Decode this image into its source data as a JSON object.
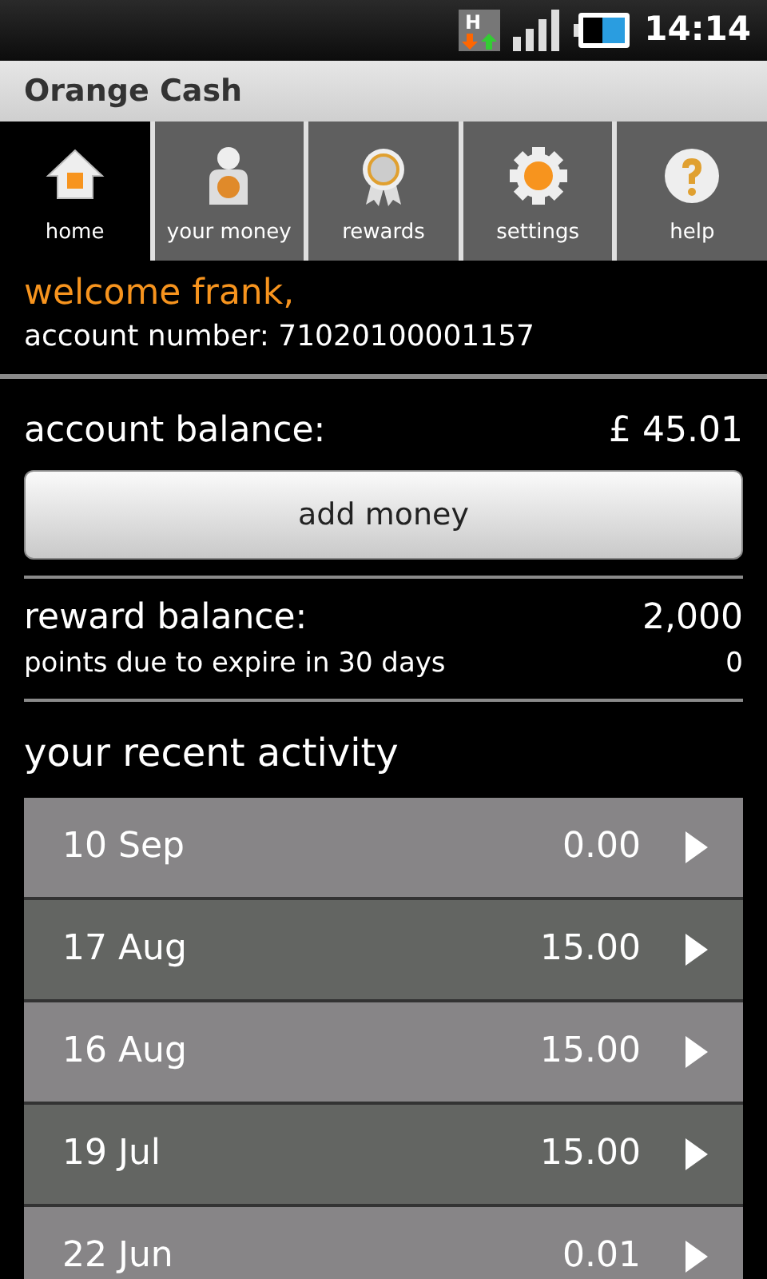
{
  "status_bar": {
    "network": "H",
    "time": "14:14"
  },
  "window": {
    "title": "Orange Cash"
  },
  "tabs": [
    {
      "label": "home",
      "kind": "house",
      "selected": true
    },
    {
      "label": "your money",
      "kind": "person",
      "selected": false
    },
    {
      "label": "rewards",
      "kind": "rosette",
      "selected": false
    },
    {
      "label": "settings",
      "kind": "gear",
      "selected": false
    },
    {
      "label": "help",
      "kind": "question",
      "selected": false
    }
  ],
  "welcome": {
    "greeting": "welcome frank,",
    "account_number": "account number: 71020100001157"
  },
  "account_balance": {
    "label": "account balance:",
    "value": "£ 45.01",
    "button": "add money"
  },
  "reward_balance": {
    "label": "reward balance:",
    "value": "2,000",
    "expire_label": "points due to expire in 30 days",
    "expire_value": "0"
  },
  "activity": {
    "title": "your recent activity",
    "rows": [
      {
        "date": "10 Sep",
        "amount": "0.00"
      },
      {
        "date": "17 Aug",
        "amount": "15.00"
      },
      {
        "date": "16 Aug",
        "amount": "15.00"
      },
      {
        "date": "19 Jul",
        "amount": "15.00"
      },
      {
        "date": "22 Jun",
        "amount": "0.01"
      }
    ]
  }
}
